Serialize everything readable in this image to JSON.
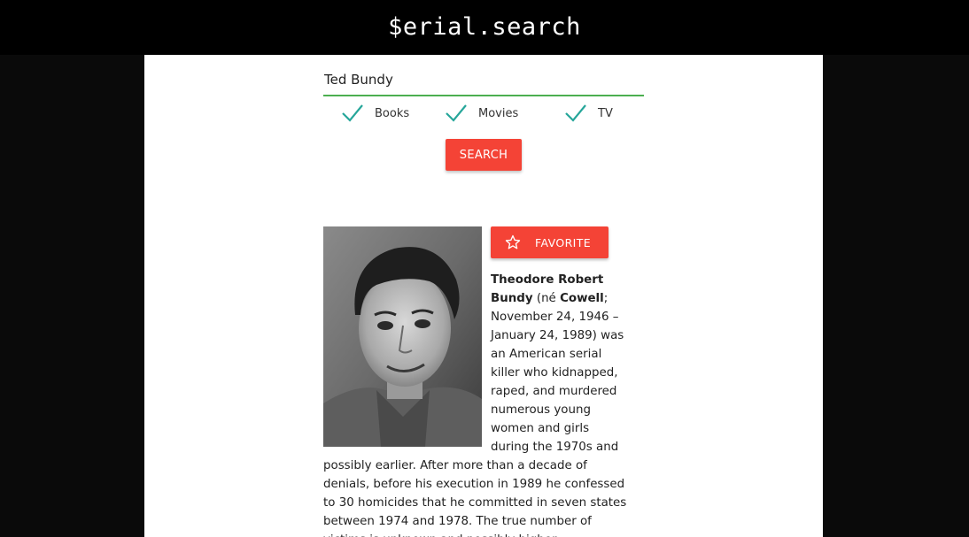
{
  "header": {
    "brand": "$erial.search"
  },
  "search": {
    "query": "Ted Bundy",
    "filters": [
      {
        "label": "Books",
        "checked": true
      },
      {
        "label": "Movies",
        "checked": true
      },
      {
        "label": "TV",
        "checked": true
      }
    ],
    "button_label": "SEARCH"
  },
  "result": {
    "favorite_label": "FAVORITE",
    "name_bold": "Theodore Robert Bundy",
    "nee_prefix": " (né ",
    "nee_bold": "Cowell",
    "bio_text": "; November 24, 1946 – January 24, 1989) was an American serial killer who kidnapped, raped, and murdered numerous young women and girls during the 1970s and possibly earlier. After more than a decade of denials, before his execution in 1989 he confessed to 30 homicides that he committed in seven states between 1974 and 1978. The true number of victims is unknown and possibly higher."
  },
  "colors": {
    "accent": "#f44336",
    "check": "#26a69a",
    "underline": "#4caf50"
  }
}
